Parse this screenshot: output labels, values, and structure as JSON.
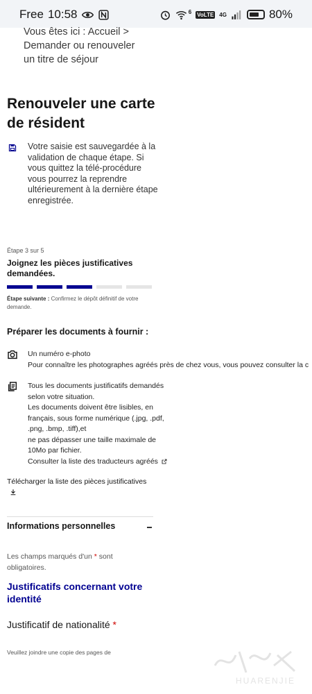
{
  "status_bar": {
    "carrier": "Free",
    "time": "10:58",
    "network_labels": [
      "6",
      "VoLTE",
      "4G"
    ],
    "battery": "80%"
  },
  "breadcrumb": {
    "prefix": "Vous êtes ici :",
    "path": "Accueil > Demander ou renouveler un titre de séjour"
  },
  "page": {
    "title": "Renouveler une carte de résident"
  },
  "save_notice": {
    "text": "Votre saisie est sauvegardée à la validation de chaque étape. Si vous quittez la télé-procédure vous pourrez la reprendre ultérieurement à la dernière étape enregistrée."
  },
  "stepper": {
    "step_label": "Étape 3 sur 5",
    "current_step": 3,
    "total_steps": 5,
    "title": "Joignez les pièces justificatives demandées.",
    "next_label": "Étape suivante :",
    "next_text": "Confirmez le dépôt définitif de votre demande."
  },
  "prepare": {
    "title": "Préparer les documents à fournir :",
    "photo": {
      "line1": "Un numéro e-photo",
      "line2": "Pour connaître les photographes agréés près de chez vous, vous pouvez consulter la c"
    },
    "documents": {
      "line1": "Tous les documents justificatifs demandés",
      "line2": "selon votre situation.",
      "line3": "Les documents doivent être lisibles, en",
      "line4": "français, sous forme numérique (.jpg, .pdf,",
      "line5": ".png, .bmp, .tiff),et",
      "line6": "ne pas dépasser une taille maximale de",
      "line7": "10Mo par fichier.",
      "translators_link": "Consulter la liste des traducteurs agréés"
    }
  },
  "download": {
    "label": "Télécharger la liste des pièces justificatives"
  },
  "accordion": {
    "title": "Informations personnelles"
  },
  "form": {
    "required_before": "Les champs marqués d'un",
    "required_star": "*",
    "required_after": "sont obligatoires.",
    "section_title": "Justificatifs concernant votre identité",
    "field_label": "Justificatif de nationalité",
    "field_star": "*",
    "hint": "Veuillez joindre une copie des pages de"
  },
  "watermark": {
    "text": "HUARENJIE"
  },
  "colors": {
    "primary": "#000091",
    "required": "#ce0500",
    "status_bg": "#f2f4f7"
  }
}
